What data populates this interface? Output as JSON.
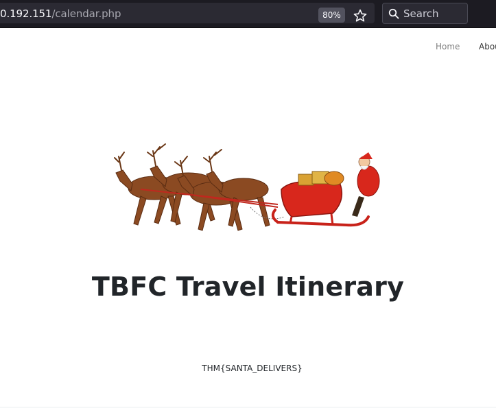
{
  "browser": {
    "url_host": "0.192.151",
    "url_path": "/calendar.php",
    "zoom": "80%",
    "search_placeholder": "Search"
  },
  "nav": {
    "items": [
      {
        "label": "Home"
      },
      {
        "label": "Abou"
      }
    ]
  },
  "hero": {
    "image_name": "santa-sleigh-reindeer"
  },
  "main": {
    "title": "TBFC Travel Itinerary",
    "flag": "THM{SANTA_DELIVERS}"
  },
  "colors": {
    "toolbar_bg": "#1c1b22",
    "reindeer": "#8b4a22",
    "sleigh": "#d8271c",
    "title": "#212529"
  }
}
